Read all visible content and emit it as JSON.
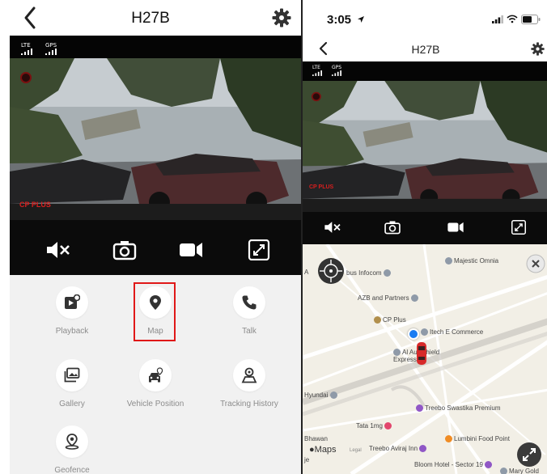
{
  "left_app": {
    "title": "H27B",
    "signals": {
      "lte_label": "LTE",
      "gps_label": "GPS"
    },
    "video_overlay": {
      "brand": "CP PLUS"
    },
    "controls": [
      "mute-icon",
      "camera-icon",
      "record-icon",
      "fullscreen-icon"
    ],
    "menu": [
      {
        "label": "Playback",
        "icon": "playback-icon"
      },
      {
        "label": "Map",
        "icon": "map-pin-icon",
        "highlighted": true
      },
      {
        "label": "Talk",
        "icon": "phone-icon"
      },
      {
        "label": "Gallery",
        "icon": "gallery-icon"
      },
      {
        "label": "Vehicle Position",
        "icon": "vehicle-position-icon"
      },
      {
        "label": "Tracking History",
        "icon": "tracking-history-icon"
      },
      {
        "label": "Geofence",
        "icon": "geofence-icon"
      }
    ],
    "highlight_color": "#e01818"
  },
  "right_app": {
    "status_time": "3:05",
    "title": "H27B",
    "signals": {
      "lte_label": "LTE",
      "gps_label": "GPS"
    },
    "video_overlay": {
      "brand": "CP PLUS"
    },
    "map": {
      "labels": {
        "bus_infocom": "bus Infocom",
        "majestic_omnia": "Majestic Omnia",
        "azb_partners": "AZB and Partners",
        "cp_plus": "CP Plus",
        "itech": "Itech E Commerce",
        "autoshield": "Al Autoshield Express",
        "hyundai": "Hyundai",
        "treebo_swastika": "Treebo Swastika Premium",
        "tata_1mg": "Tata 1mg",
        "bhawan": "Bhawan",
        "treebo_aviraj": "Treebo Aviraj Inn",
        "lumbini": "Lumbini Food Point",
        "maps_brand": "Maps",
        "legal": "Legal",
        "bloom": "Bloom Hotel - Sector 19",
        "mary": "Mary Gold",
        "edge_a": "A",
        "edge_je": "je"
      }
    }
  }
}
